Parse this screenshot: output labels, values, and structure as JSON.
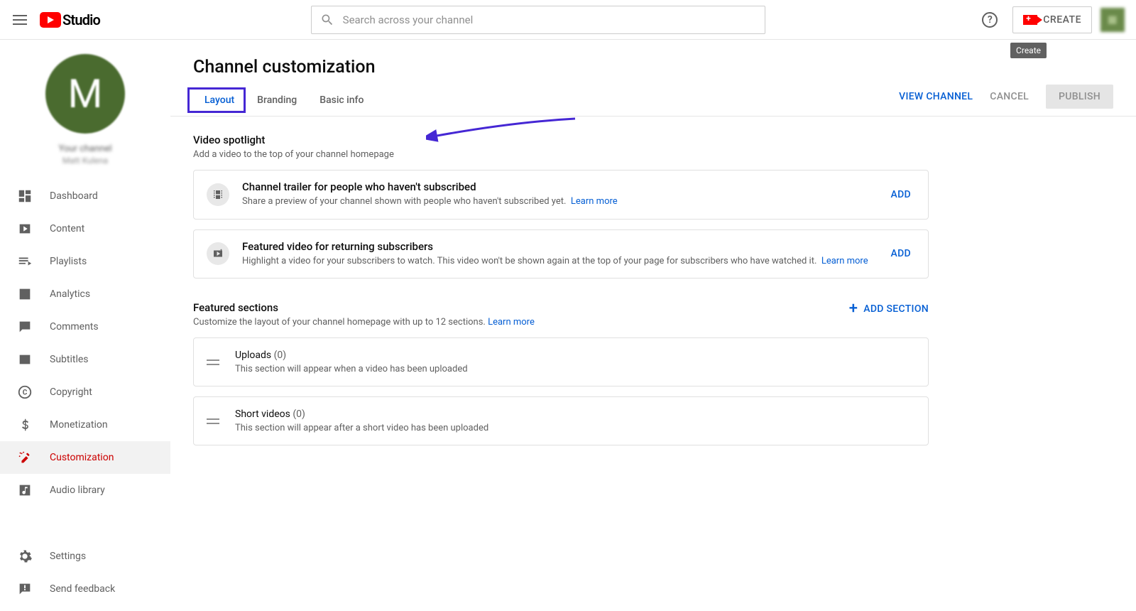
{
  "header": {
    "brand": "Studio",
    "search_placeholder": "Search across your channel",
    "help_text": "?",
    "create_label": "CREATE",
    "create_tooltip": "Create"
  },
  "sidebar": {
    "avatar_letter": "M",
    "channel_label": "Your channel",
    "channel_name": "Matt Kulena",
    "items": [
      {
        "label": "Dashboard"
      },
      {
        "label": "Content"
      },
      {
        "label": "Playlists"
      },
      {
        "label": "Analytics"
      },
      {
        "label": "Comments"
      },
      {
        "label": "Subtitles"
      },
      {
        "label": "Copyright"
      },
      {
        "label": "Monetization"
      },
      {
        "label": "Customization"
      },
      {
        "label": "Audio library"
      }
    ],
    "bottom": [
      {
        "label": "Settings"
      },
      {
        "label": "Send feedback"
      }
    ]
  },
  "page": {
    "title": "Channel customization",
    "tabs": [
      {
        "label": "Layout"
      },
      {
        "label": "Branding"
      },
      {
        "label": "Basic info"
      }
    ],
    "actions": {
      "view_channel": "VIEW CHANNEL",
      "cancel": "CANCEL",
      "publish": "PUBLISH"
    },
    "spotlight": {
      "title": "Video spotlight",
      "sub": "Add a video to the top of your channel homepage",
      "trailer": {
        "title": "Channel trailer for people who haven't subscribed",
        "desc": "Share a preview of your channel shown with people who haven't subscribed yet.",
        "learn": "Learn more",
        "action": "ADD"
      },
      "featured": {
        "title": "Featured video for returning subscribers",
        "desc": "Highlight a video for your subscribers to watch. This video won't be shown again at the top of your page for subscribers who have watched it.",
        "learn": "Learn more",
        "action": "ADD"
      }
    },
    "sections": {
      "title": "Featured sections",
      "sub": "Customize the layout of your channel homepage with up to 12 sections.",
      "learn": "Learn more",
      "add_label": "ADD SECTION",
      "items": [
        {
          "title": "Uploads",
          "count": "(0)",
          "desc": "This section will appear when a video has been uploaded"
        },
        {
          "title": "Short videos",
          "count": "(0)",
          "desc": "This section will appear after a short video has been uploaded"
        }
      ]
    }
  }
}
